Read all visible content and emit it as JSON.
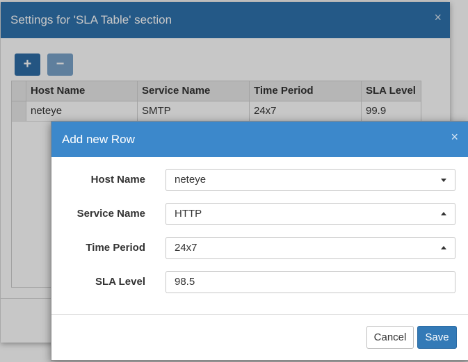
{
  "background_dialog": {
    "title": "Settings for 'SLA Table' section",
    "close_glyph": "×",
    "add_glyph": "+",
    "remove_glyph": "−",
    "columns": [
      "Host Name",
      "Service Name",
      "Time Period",
      "SLA Level"
    ],
    "rows": [
      [
        "neteye",
        "SMTP",
        "24x7",
        "99.9"
      ]
    ]
  },
  "modal": {
    "title": "Add new Row",
    "close_glyph": "×",
    "fields": {
      "host_name": {
        "label": "Host Name",
        "value": "neteye"
      },
      "service_name": {
        "label": "Service Name",
        "value": "HTTP"
      },
      "time_period": {
        "label": "Time Period",
        "value": "24x7"
      },
      "sla_level": {
        "label": "SLA Level",
        "value": "98.5"
      }
    },
    "cancel_label": "Cancel",
    "save_label": "Save"
  },
  "colors": {
    "bg_header": "#2f72ad",
    "modal_header": "#3c88cb",
    "primary_button": "#337ab7"
  }
}
